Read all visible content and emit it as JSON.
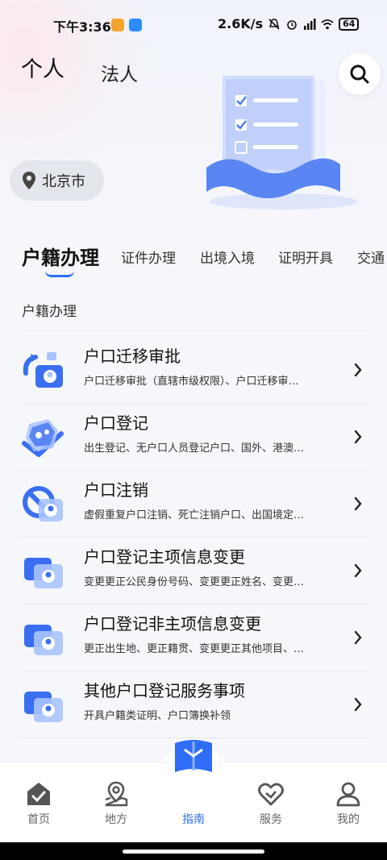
{
  "status_bar": {
    "time": "下午3:36",
    "net_speed": "2.6K/s",
    "battery": "64"
  },
  "top_tabs": {
    "personal": "个人",
    "legal": "法人"
  },
  "location": {
    "city": "北京市"
  },
  "category_tabs": [
    "户籍办理",
    "证件办理",
    "出境入境",
    "证明开具",
    "交通"
  ],
  "section": {
    "title": "户籍办理"
  },
  "items": [
    {
      "title": "户口迁移审批",
      "subtitle": "户口迁移审批（直辖市级权限）、户口迁移审…"
    },
    {
      "title": "户口登记",
      "subtitle": "出生登记、无户口人员登记户口、国外、港澳…"
    },
    {
      "title": "户口注销",
      "subtitle": "虚假重复户口注销、死亡注销户口、出国境定…"
    },
    {
      "title": "户口登记主项信息变更",
      "subtitle": "变更更正公民身份号码、变更更正姓名、变更…"
    },
    {
      "title": "户口登记非主项信息变更",
      "subtitle": "更正出生地、更正籍贯、变更更正其他项目、…"
    },
    {
      "title": "其他户口登记服务事项",
      "subtitle": "开具户籍类证明、户口簿换补领"
    }
  ],
  "bottom_nav": {
    "items": [
      "首页",
      "地方",
      "指南",
      "服务",
      "我的"
    ],
    "active_index": 2
  },
  "colors": {
    "accent": "#2f6df6",
    "icon_light": "#a9c3ff"
  }
}
